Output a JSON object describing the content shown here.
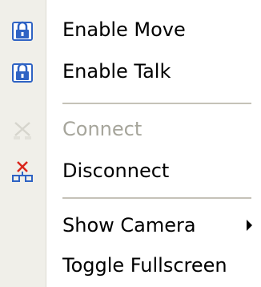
{
  "menu": {
    "items": [
      {
        "label": "Enable Move",
        "icon": "lock-icon",
        "enabled": true
      },
      {
        "label": "Enable Talk",
        "icon": "lock-icon",
        "enabled": true
      },
      {
        "label": "Connect",
        "icon": "connect-icon",
        "enabled": false
      },
      {
        "label": "Disconnect",
        "icon": "disconnect-icon",
        "enabled": true
      },
      {
        "label": "Show Camera",
        "icon": "",
        "enabled": true,
        "submenu": true
      },
      {
        "label": "Toggle Fullscreen",
        "icon": "",
        "enabled": true
      }
    ]
  },
  "colors": {
    "icon_blue": "#2f63c4",
    "icon_red": "#d9261c",
    "disabled_text": "#a6a59b",
    "gutter": "#f0efe9",
    "separator": "#c5c2b8"
  }
}
